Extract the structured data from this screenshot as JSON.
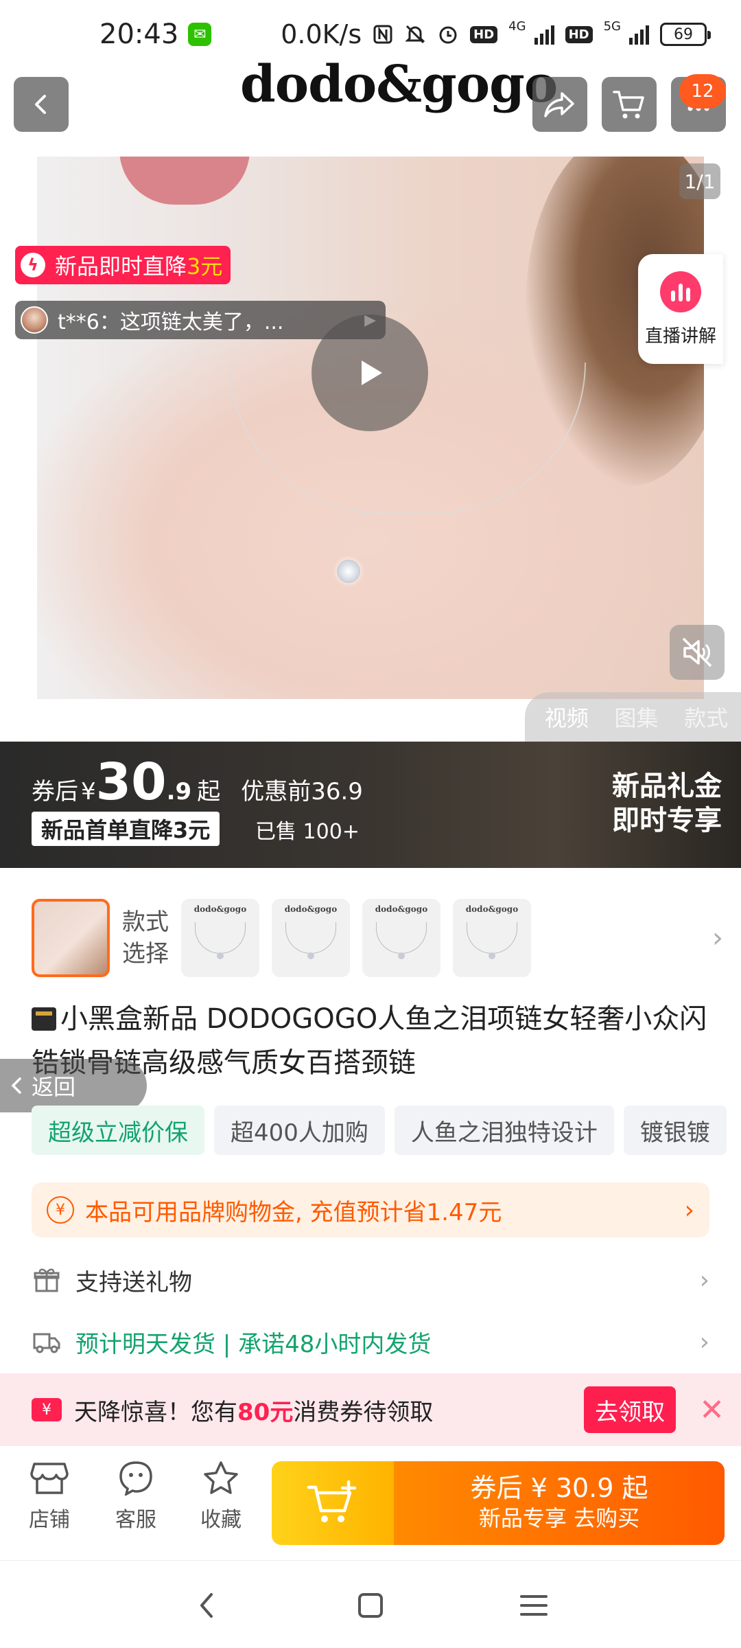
{
  "status_bar": {
    "time": "20:43",
    "network_speed": "0.0K/s",
    "net_type_1": "4G",
    "net_type_2": "5G",
    "hd_label": "HD",
    "battery": "69"
  },
  "header": {
    "brand": "dodo&gogo",
    "cart_count": "12"
  },
  "media": {
    "image_counter": "1/1",
    "promo_tag": {
      "text": "新品即时直降",
      "highlight": "3元"
    },
    "review": {
      "text": "t**6：这项链太美了，..."
    },
    "live_label": "直播讲解",
    "tabs": [
      {
        "label": "视频",
        "active": true
      },
      {
        "label": "图集",
        "active": false
      },
      {
        "label": "款式",
        "active": false
      }
    ]
  },
  "price": {
    "prefix": "券后",
    "currency": "¥",
    "main": "30",
    "decimal": ".9",
    "suffix": "起",
    "desc": "优惠前36.9",
    "first_order": "新品首单直降3元",
    "sold": "已售 100+",
    "right_line1": "新品礼金",
    "right_line2": "即时专享"
  },
  "sku": {
    "label_line1": "款式",
    "label_line2": "选择",
    "thumb_logo": "dodo&gogo"
  },
  "title": {
    "badge": "小黑盒新品",
    "text": " DODOGOGO人鱼之泪项链女轻奢小众闪锆锁骨链高级感气质女百搭颈链"
  },
  "back_float": "返回",
  "tags": [
    "超级立减价保",
    "超400人加购",
    "人鱼之泪独特设计",
    "镀银镀"
  ],
  "gold_card": {
    "yen": "¥",
    "text": "本品可用品牌购物金, 充值预计省1.47元"
  },
  "info_rows": {
    "gift": "支持送礼物",
    "shipping": "预计明天发货 | 承诺48小时内发货"
  },
  "coupon_banner": {
    "icon_text": "¥",
    "text_before": "天降惊喜！您有",
    "amount": "80元",
    "text_after": "消费券待领取",
    "claim": "去领取"
  },
  "bottom_bar": {
    "shop": "店铺",
    "service": "客服",
    "favorite": "收藏",
    "buy_line1": "券后 ¥ 30.9 起",
    "buy_line2": "新品专享  去购买"
  },
  "colors": {
    "promo_red": "#ff2150",
    "accent_orange": "#ff5a00",
    "green": "#13a36e",
    "buy_yellow": "#ffd21a"
  }
}
